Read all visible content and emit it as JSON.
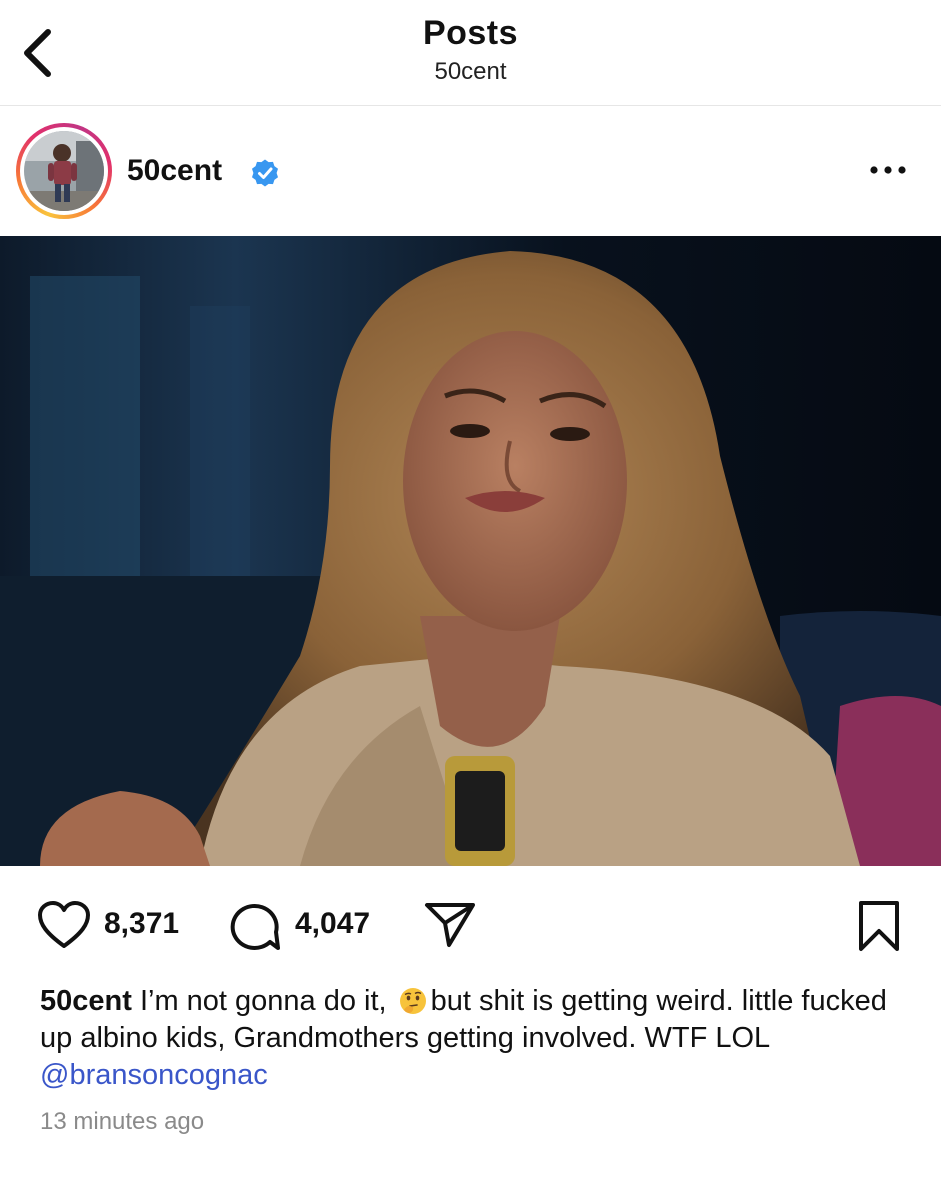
{
  "header": {
    "title": "Posts",
    "subtitle": "50cent"
  },
  "post": {
    "username": "50cent",
    "verified": true,
    "avatar_icon": "avatar-photo",
    "more_icon": "more-horizontal-icon"
  },
  "actions": {
    "likes": "8,371",
    "comments": "4,047"
  },
  "caption": {
    "username": "50cent",
    "text_before_emoji": "I’m not gonna do it, ",
    "emoji": "thinking-face",
    "text_after_emoji": "but shit is getting weird. little fucked up albino kids, Grandmothers getting involved.  WTF LOL ",
    "mention": "@bransoncognac"
  },
  "timestamp": "13 minutes ago",
  "colors": {
    "mention": "#3a56c9",
    "verified": "#3897f0",
    "muted": "#8a8a8a"
  }
}
